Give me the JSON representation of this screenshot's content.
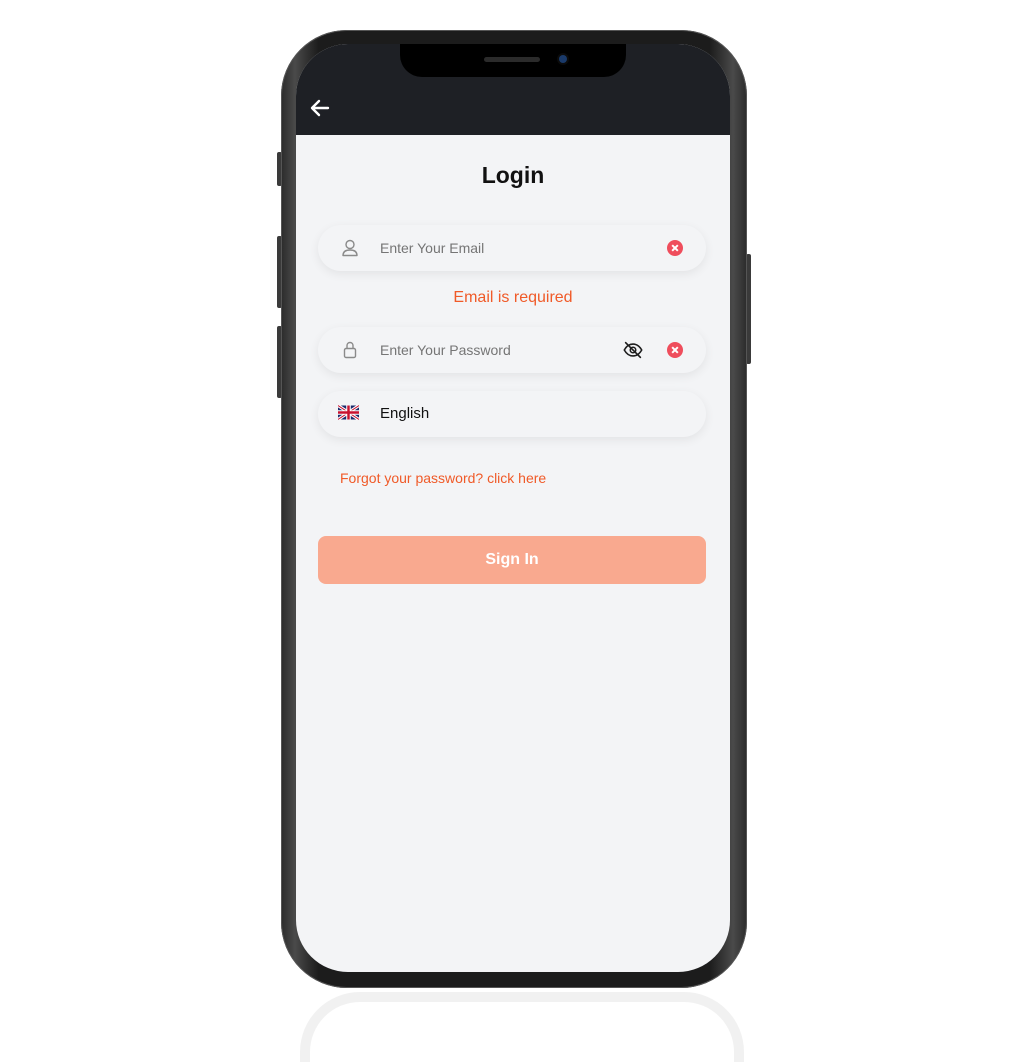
{
  "header": {
    "back_icon": "arrow-left-icon"
  },
  "login": {
    "title": "Login",
    "email": {
      "placeholder": "Enter Your Email",
      "value": "",
      "lead_icon": "user-icon",
      "clear_icon": "clear-circle-icon"
    },
    "email_error": "Email is required",
    "password": {
      "placeholder": "Enter Your Password",
      "value": "",
      "lead_icon": "lock-icon",
      "visibility_icon": "eye-off-icon",
      "clear_icon": "clear-circle-icon"
    },
    "language": {
      "label": "English",
      "flag_icon": "uk-flag-icon"
    },
    "forgot_link": "Forgot your password? click here",
    "sign_in_label": "Sign In"
  },
  "colors": {
    "accent": "#f05a28",
    "button": "#f9a98f",
    "error_clear": "#ef4d5c",
    "appbar": "#1e2025",
    "screen_bg": "#f3f4f6"
  }
}
